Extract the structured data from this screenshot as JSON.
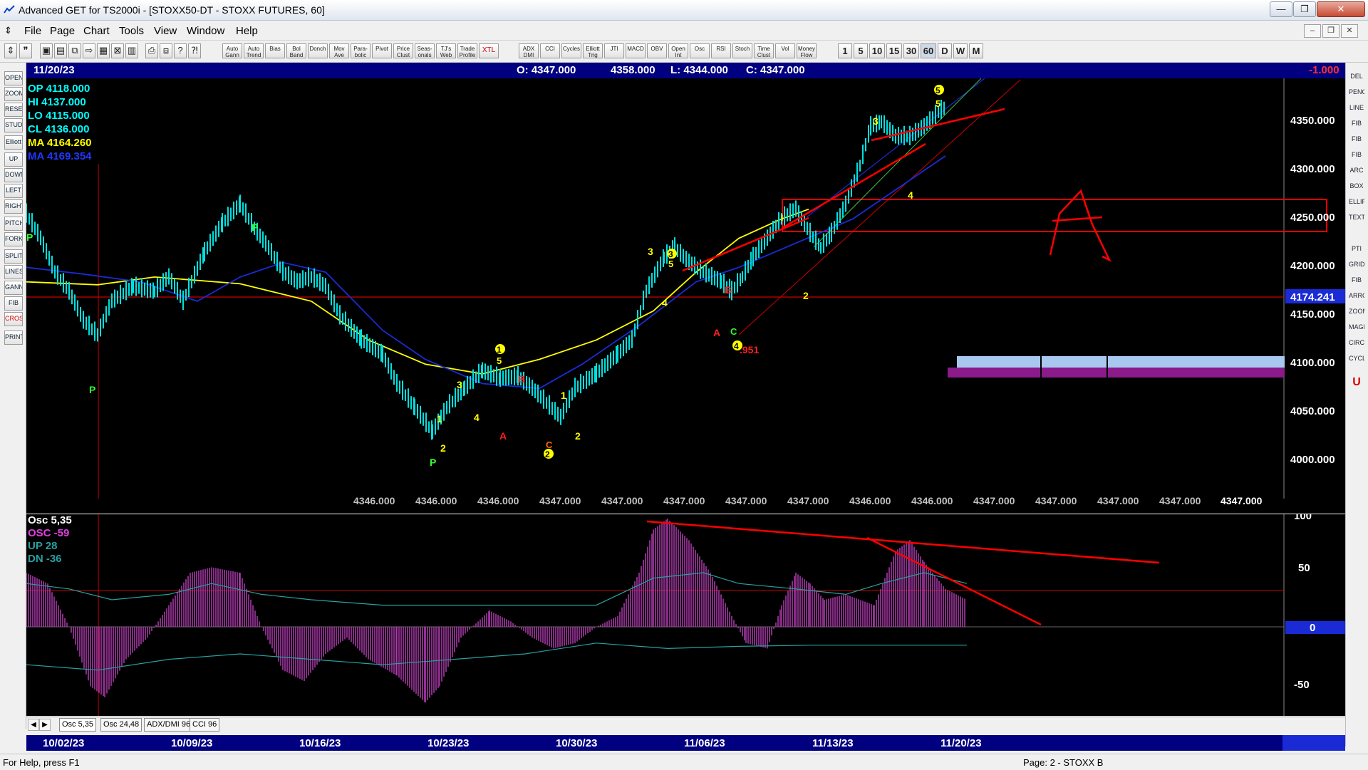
{
  "window": {
    "title": "Advanced GET for TS2000i - [STOXX50-DT - STOXX FUTURES, 60]",
    "minimize": "—",
    "restore": "❐",
    "close": "✕"
  },
  "menu": {
    "items": [
      "File",
      "Page",
      "Chart",
      "Tools",
      "View",
      "Window",
      "Help"
    ],
    "mdi": {
      "minimize": "–",
      "restore": "❐",
      "close": "✕"
    }
  },
  "toolbar": {
    "labeled_buttons": [
      "Auto Gann",
      "Auto Trend",
      "Bias",
      "Bol Band",
      "Donch",
      "Mov Ave",
      "Para-bolic",
      "Pivot",
      "Price Clust",
      "Seas-onals",
      "TJ's Web",
      "Trade Profile",
      "XTL",
      "ADX DMI",
      "CCI",
      "Cycles",
      "Elliott Trig",
      "JTI",
      "MACD",
      "OBV",
      "Open Int",
      "Osc",
      "RSI",
      "Stoch",
      "Time Clust",
      "Vol",
      "Money Flow"
    ],
    "timeframes": [
      "1",
      "5",
      "10",
      "15",
      "30",
      "60",
      "D",
      "W",
      "M"
    ],
    "active_timeframe": "60"
  },
  "left_tools": [
    "OPEN",
    "ZOOM",
    "RESET",
    "STUDY",
    "Elliott",
    "UP",
    "DOWN",
    "LEFT",
    "RIGHT",
    "PITCH",
    "FORK",
    "SPLIT",
    "LINES",
    "GANN",
    "FIB",
    "CROSS",
    "PRINT"
  ],
  "right_tools": [
    "DEL",
    "PENCIL",
    "LINE",
    "FIB RET",
    "FIB EXT",
    "FIB TIME",
    "ARC",
    "BOX",
    "ELLIPS",
    "TEXT",
    "PTI",
    "GRID",
    "FIB",
    "ARROW",
    "ZOOM",
    "MAGNET",
    "CIRCLE",
    "CYCLE",
    "U"
  ],
  "info_bar": {
    "date": "11/20/23",
    "open": "O: 4347.000",
    "high": "4358.000",
    "low": "L: 4344.000",
    "close": "C: 4347.000",
    "change": "-1.000"
  },
  "legend": {
    "op": "OP  4118.000",
    "hi": "HI   4137.000",
    "lo": "LO  4115.000",
    "cl": "CL  4136.000",
    "ma1": "MA  4164.260",
    "ma2": "MA  4169.354"
  },
  "price_axis": [
    "4350.000",
    "4300.000",
    "4250.000",
    "4200.000",
    "4150.000",
    "4100.000",
    "4050.000",
    "4000.000"
  ],
  "price_highlight": "4174.241",
  "bottom_values": [
    "4346.000",
    "4346.000",
    "4346.000",
    "4347.000",
    "4347.000",
    "4347.000",
    "4347.000",
    "4347.000",
    "4346.000",
    "4346.000",
    "4347.000",
    "4347.000",
    "4347.000",
    "4347.000"
  ],
  "bottom_value_last": "4347.000",
  "chart_labels": {
    "p": "P",
    "one": "1",
    "two": "2",
    "three": "3",
    "four": "4",
    "five": "5",
    "a": "A",
    "b": "B",
    "c": "C",
    "fib_ratio": ".951",
    "one_upper": "I",
    "three_upper": "3"
  },
  "osc_legend": {
    "name": "Osc 5,35",
    "osc": "OSC -59",
    "up": "UP   28",
    "dn": "DN   -36"
  },
  "osc_axis": [
    "100",
    "50",
    "0",
    "-50"
  ],
  "osc_tabs": [
    "Osc 5,35",
    "Osc 24,48",
    "ADX/DMI 96",
    "CCI 96"
  ],
  "dates": [
    "10/02/23",
    "10/09/23",
    "10/16/23",
    "10/23/23",
    "10/30/23",
    "11/06/23",
    "11/13/23",
    "11/20/23"
  ],
  "status": {
    "help": "For Help, press F1",
    "page": "Page: 2 - STOXX B"
  },
  "colors": {
    "chart_bg": "#000000",
    "price_bars": "#00ffff",
    "ma_yellow": "#ffff00",
    "ma_blue": "#0000ff",
    "trendline_red": "#ff0000",
    "oscillator": "#cc44cc",
    "legend_cyan": "#00ffff",
    "info_bar": "#000080"
  }
}
